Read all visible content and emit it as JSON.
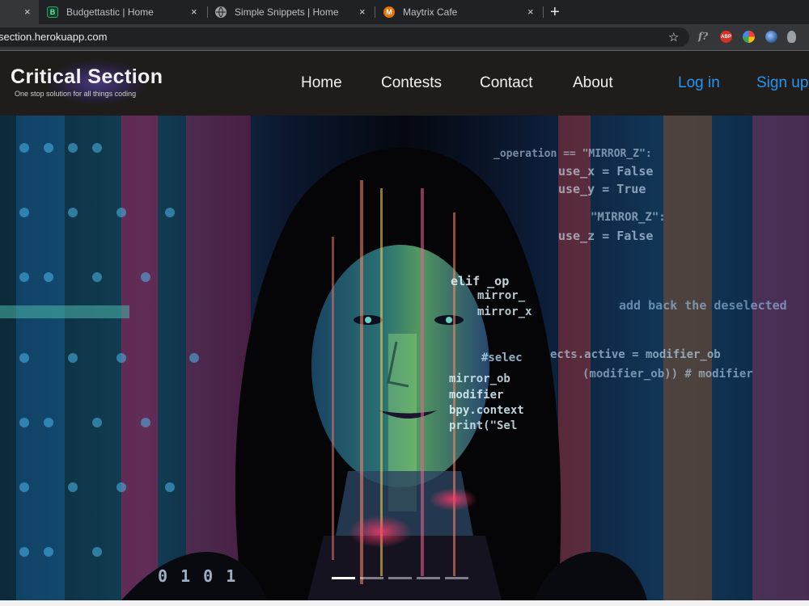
{
  "browser": {
    "tabs": [
      {
        "title": "",
        "active": true
      },
      {
        "title": "Budgettastic | Home",
        "favicon": "B",
        "active": false
      },
      {
        "title": "Simple Snippets | Home",
        "favicon": "globe-icon",
        "active": false
      },
      {
        "title": "Maytrix Cafe",
        "favicon": "M",
        "active": false
      }
    ],
    "close_glyph": "×",
    "new_tab_glyph": "+",
    "url": "section.herokuapp.com",
    "star_glyph": "☆",
    "extensions": {
      "formula": "f?",
      "abp": "ABP"
    }
  },
  "site": {
    "logo": {
      "title": "Critical Section",
      "tagline": "One stop solution for all things coding"
    },
    "nav": {
      "home": "Home",
      "contests": "Contests",
      "contact": "Contact",
      "about": "About",
      "login": "Log in",
      "signup": "Sign up"
    },
    "colors": {
      "nav_bg": "#201c1a",
      "link": "#f1f1f1",
      "auth_link": "#2196f3"
    }
  },
  "carousel": {
    "slides": 5,
    "active_index": 0,
    "code_text": [
      "elif _op",
      "mirror_",
      "mirror_x",
      "#selec",
      "mirror_ob",
      "modifier",
      "bpy.context",
      "print(\"Sel",
      "_operation == \"MIRROR_Z\":",
      "use_x = False",
      "use_y = True",
      "use_z = False",
      "\"MIRROR_Z\":",
      "add back the deselected",
      "ects.active = modifier_ob",
      "(modifier_ob)) # modifier",
      "0 1 0 1"
    ]
  }
}
